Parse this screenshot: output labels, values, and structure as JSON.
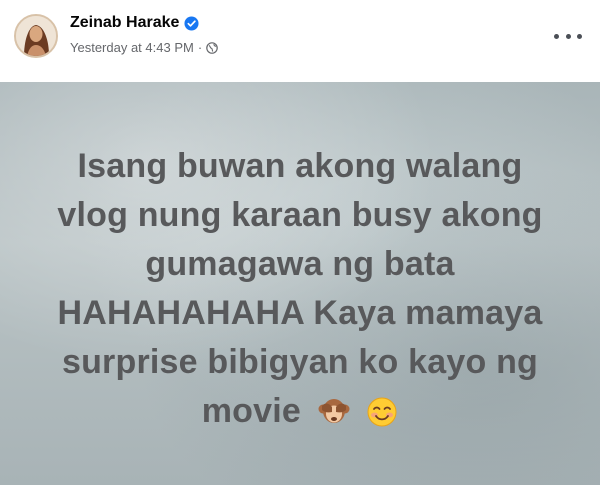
{
  "author": {
    "name": "Zeinab Harake",
    "verified": true
  },
  "meta": {
    "timestamp": "Yesterday at 4:43 PM",
    "separator": "·",
    "audience_icon": "globe-icon"
  },
  "more_icon": "more-options-icon",
  "post": {
    "lines": [
      "Isang buwan akong walang",
      "vlog nung karaan busy akong",
      "gumagawa ng bata",
      "HAHAHAHAHA Kaya mamaya",
      "surprise bibigyan ko kayo ng",
      "movie"
    ],
    "emojis": [
      "see-no-evil-monkey-emoji",
      "smiling-face-emoji"
    ],
    "text_color": "#58595b"
  },
  "colors": {
    "verified_badge": "#1877f2",
    "meta_text": "#65676b",
    "name_text": "#050505"
  }
}
